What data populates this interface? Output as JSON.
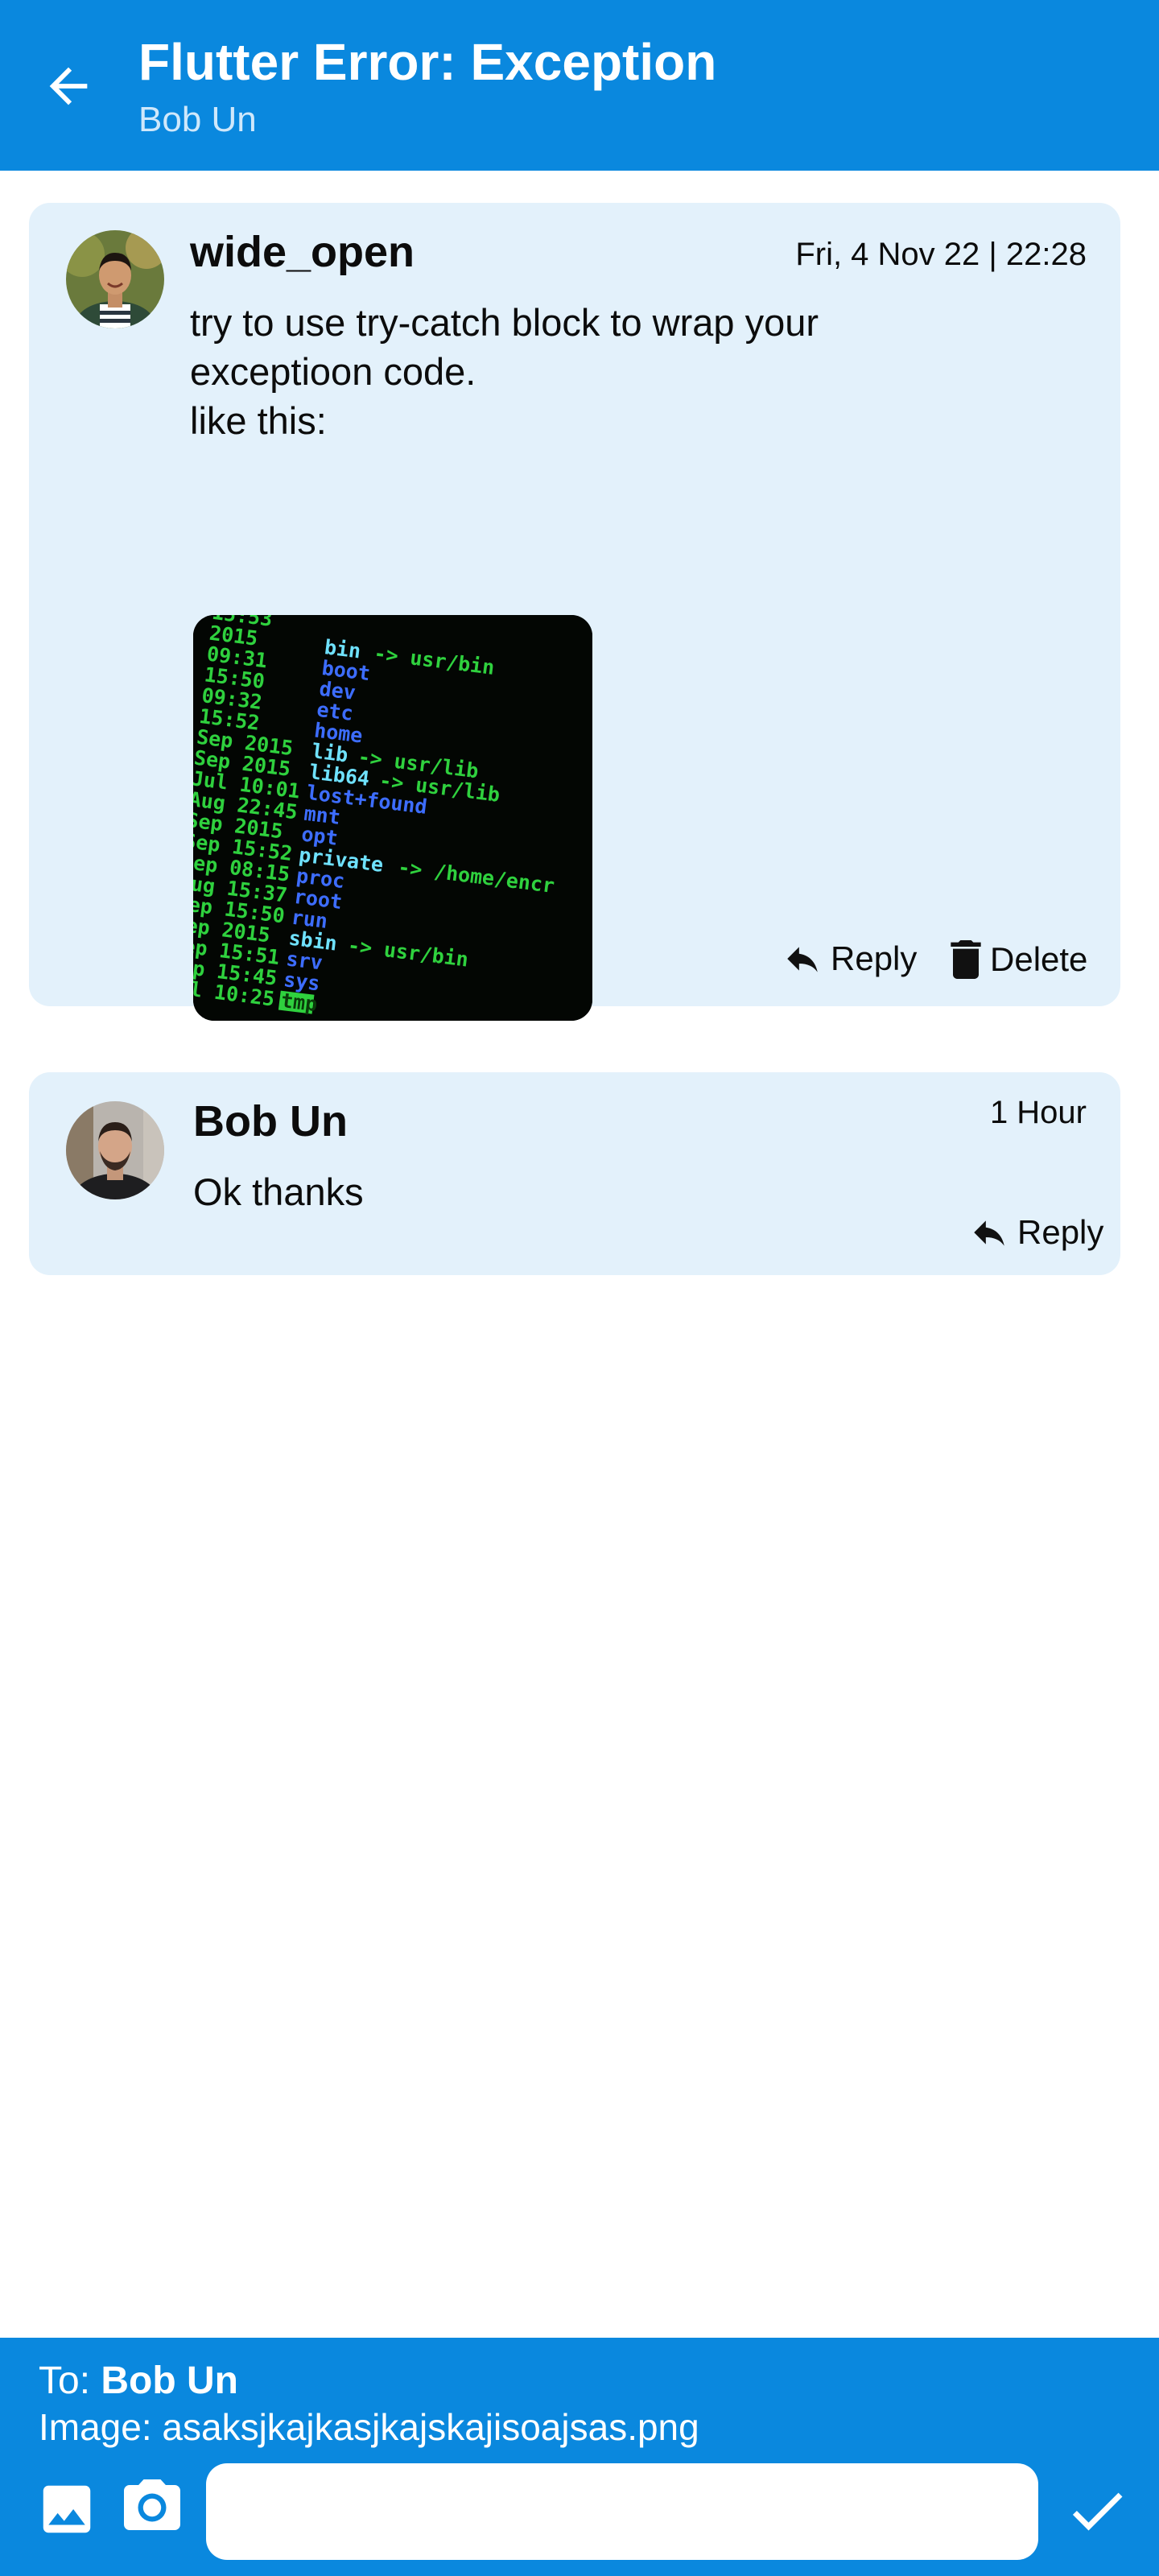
{
  "appbar": {
    "title": "Flutter Error: Exception",
    "subtitle": "Bob Un",
    "back_icon": "arrow-left-icon"
  },
  "thread": [
    {
      "author": "wide_open",
      "timestamp": "Fri, 4 Nov 22 | 22:28",
      "body": "try to use try-catch block to wrap your\nexceptioon code.\nlike this:",
      "attachment_icon": "terminal-screenshot",
      "actions": {
        "reply_label": "Reply",
        "delete_label": "Delete"
      }
    },
    {
      "author": "Bob Un",
      "timestamp": "1 Hour",
      "body": "Ok thanks",
      "actions": {
        "reply_label": "Reply"
      }
    }
  ],
  "composer": {
    "to_prefix": "To: ",
    "to_name": "Bob Un",
    "image_line": "Image: asaksjkajkasjkajskajisoajsas.png",
    "message_value": "",
    "gallery_icon": "image-icon",
    "camera_icon": "camera-icon",
    "send_icon": "check-icon"
  },
  "colors": {
    "primary": "#0a88de",
    "card": "#e3f1fb",
    "subtitle": "#cfe8fb"
  }
}
